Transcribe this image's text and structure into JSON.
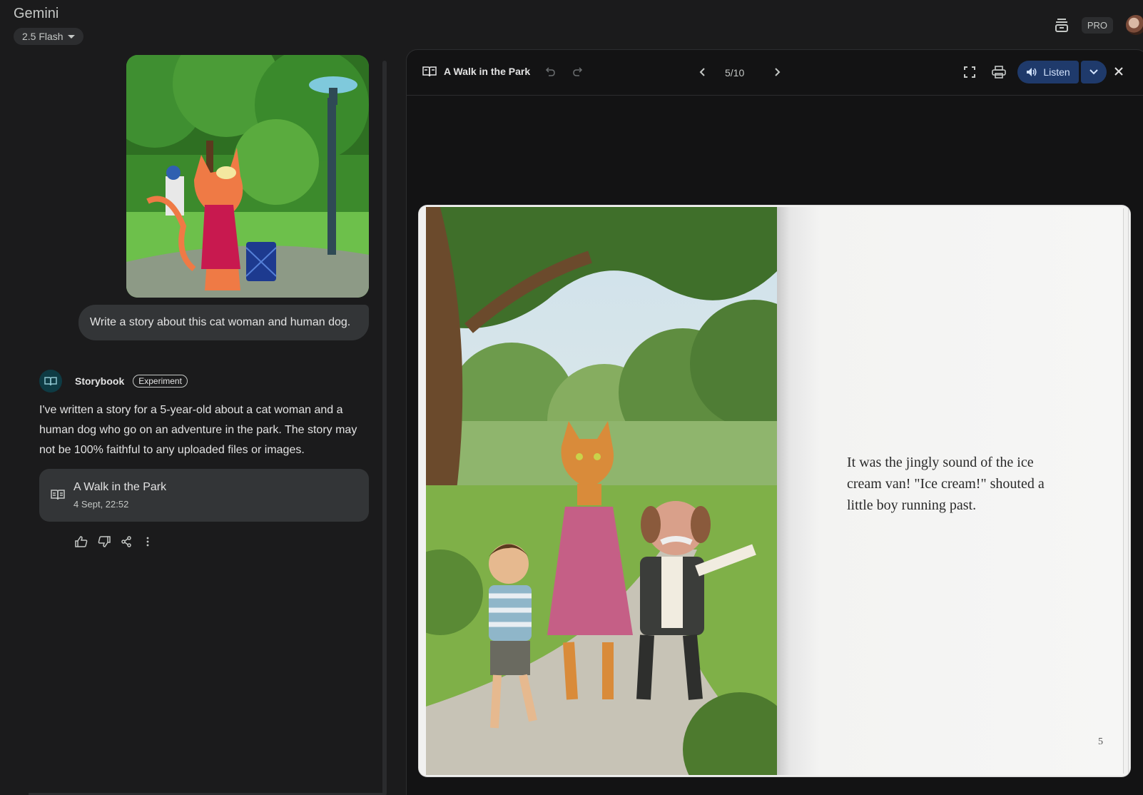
{
  "app": {
    "brand": "Gemini",
    "model": "2.5 Flash",
    "pro_badge": "PRO"
  },
  "chat": {
    "user_message": "Write a story about this cat woman and human dog.",
    "response": {
      "title": "Storybook",
      "badge": "Experiment",
      "text": "I've written a story for a 5-year-old about a cat woman and a human dog who go on an adventure in the park. The story may not be 100% faithful to any uploaded files or images.",
      "card_title": "A Walk in the Park",
      "card_date": "4 Sept, 22:52"
    }
  },
  "viewer": {
    "title": "A Walk in the Park",
    "page_indicator": "5/10",
    "listen_label": "Listen",
    "page_text": "It was the jingly sound of the ice cream van! \"Ice cream!\" shouted a little boy running past.",
    "page_number": "5"
  },
  "colors": {
    "background": "#1b1b1c",
    "accent": "#1f3a6b",
    "bubble": "#333537"
  }
}
